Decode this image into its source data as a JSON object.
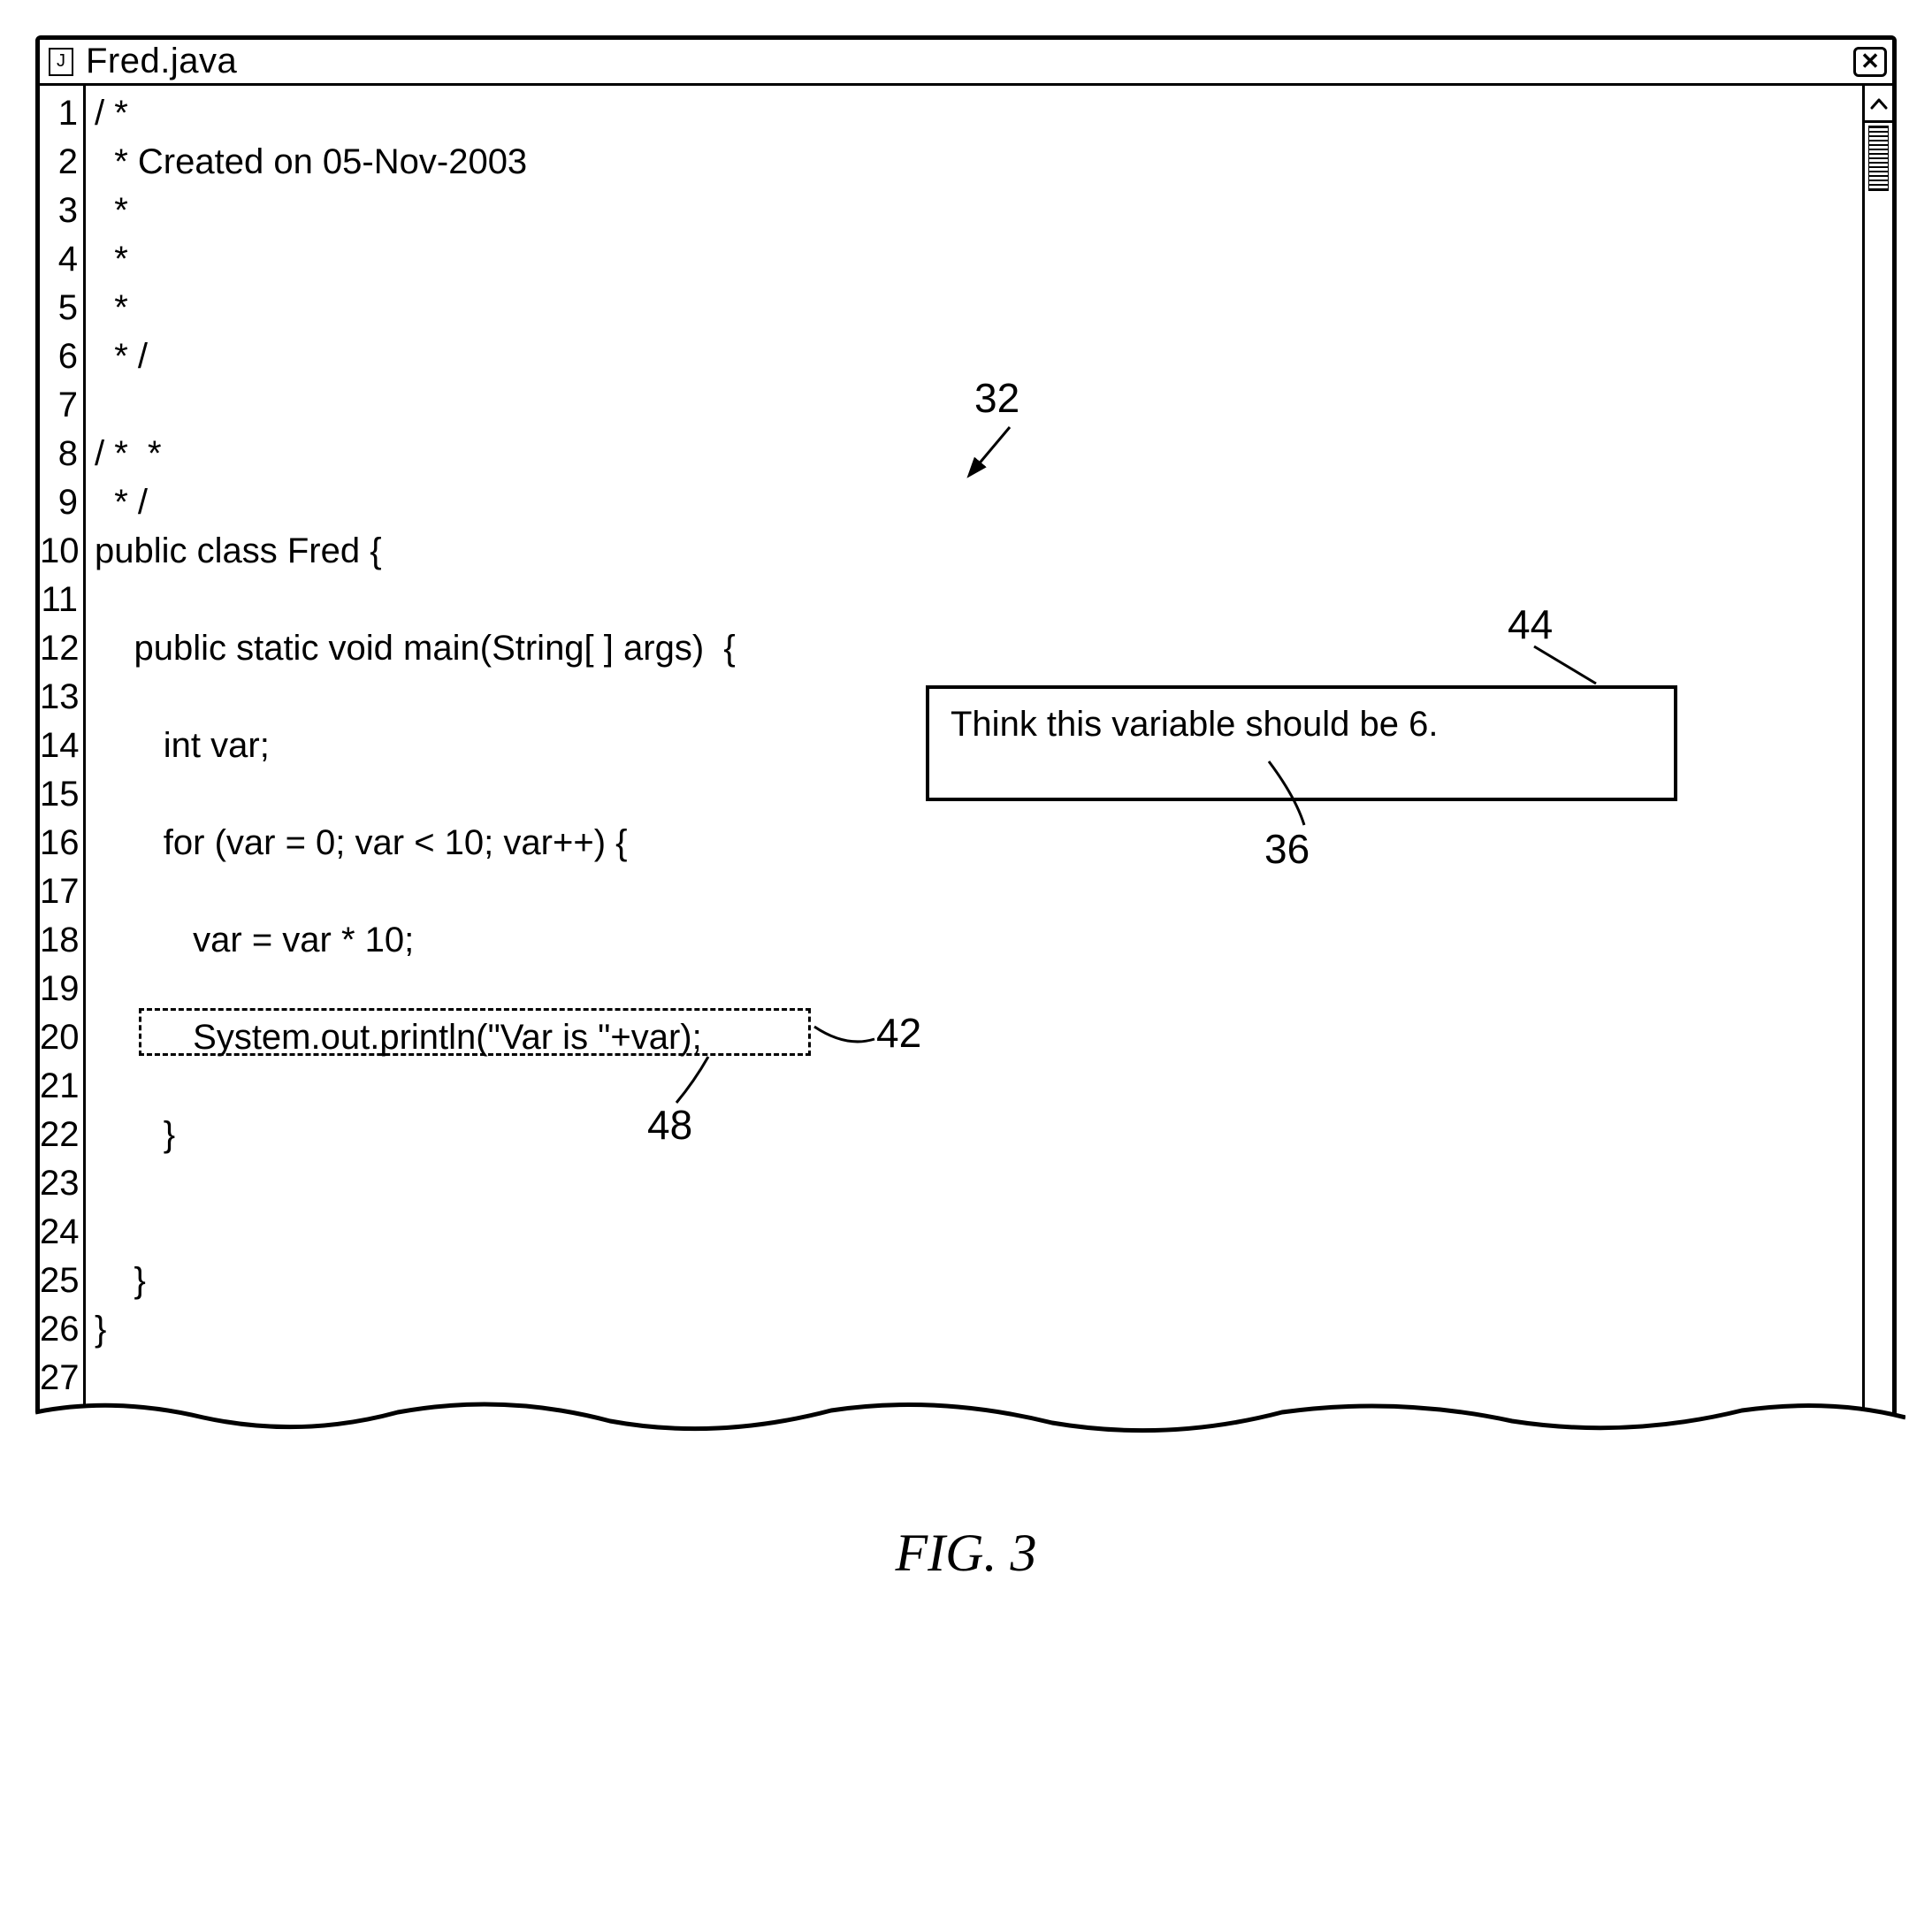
{
  "title": "Fred.java",
  "annotation": {
    "text": "Think this variable should be 6."
  },
  "callouts": {
    "c32": "32",
    "c36": "36",
    "c42": "42",
    "c44": "44",
    "c48": "48"
  },
  "figure_caption": "FIG. 3",
  "code_lines": [
    "/ *",
    "  * Created on 05-Nov-2003",
    "  *",
    "  *",
    "  *",
    "  * /",
    "",
    "/ *  *",
    "  * /",
    "public class Fred {",
    "",
    "    public static void main(String[ ] args)  {",
    "",
    "       int var;",
    "",
    "       for (var = 0; var < 10; var++) {",
    "",
    "          var = var * 10;",
    "",
    "          System.out.println(\"Var is \"+var);",
    "",
    "       }",
    "",
    "",
    "    }",
    "}",
    ""
  ],
  "line_numbers": [
    1,
    2,
    3,
    4,
    5,
    6,
    7,
    8,
    9,
    10,
    11,
    12,
    13,
    14,
    15,
    16,
    17,
    18,
    19,
    20,
    21,
    22,
    23,
    24,
    25,
    26,
    27
  ]
}
